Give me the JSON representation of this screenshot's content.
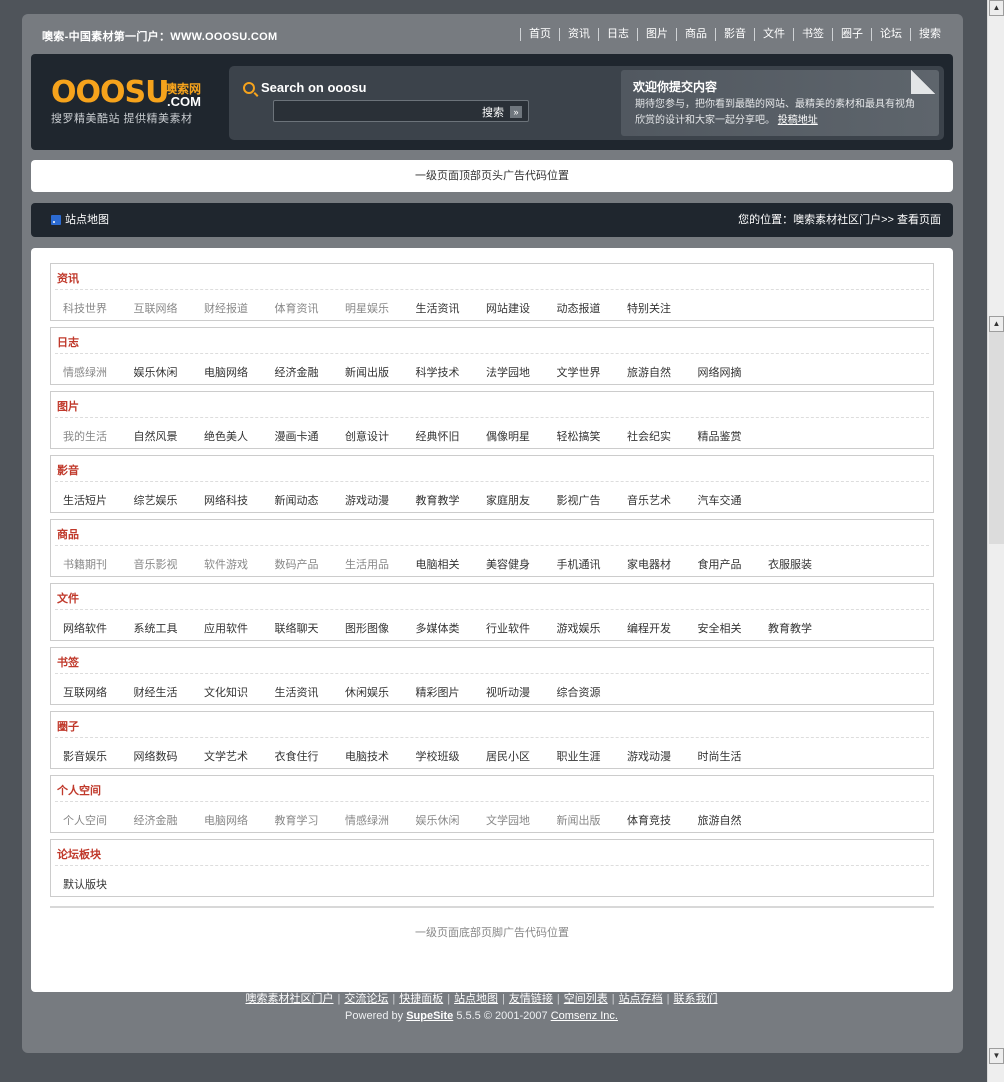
{
  "topbar": {
    "site_title": "噢索-中国素材第一门户：WWW.OOOSU.COM",
    "nav": [
      "首页",
      "资讯",
      "日志",
      "图片",
      "商品",
      "影音",
      "文件",
      "书签",
      "圈子",
      "论坛",
      "搜索"
    ]
  },
  "logo": {
    "word": "OOOSU",
    "cn": "噢索网",
    "com": ".COM",
    "slogan": "搜罗精美酷站 提供精美素材"
  },
  "search": {
    "title": "Search on ooosu",
    "button": "搜索",
    "value": ""
  },
  "submit": {
    "title": "欢迎你提交内容",
    "text": "期待您参与，把你看到最酷的网站、最精美的素材和最具有视角欣赏的设计和大家一起分享吧。",
    "link": "投稿地址"
  },
  "ad_top": "一级页面顶部页头广告代码位置",
  "crumb": {
    "sitemap": "站点地图",
    "position": "您的位置：噢索素材社区门户>> 查看页面"
  },
  "sections": [
    {
      "title": "资讯",
      "items": [
        "科技世界",
        "互联网络",
        "财经报道",
        "体育资讯",
        "明星娱乐",
        "生活资讯",
        "网站建设",
        "动态报道",
        "特别关注"
      ],
      "dim": 5
    },
    {
      "title": "日志",
      "items": [
        "情感绿洲",
        "娱乐休闲",
        "电脑网络",
        "经济金融",
        "新闻出版",
        "科学技术",
        "法学园地",
        "文学世界",
        "旅游自然",
        "网络网摘"
      ],
      "dim": 1
    },
    {
      "title": "图片",
      "items": [
        "我的生活",
        "自然风景",
        "绝色美人",
        "漫画卡通",
        "创意设计",
        "经典怀旧",
        "偶像明星",
        "轻松搞笑",
        "社会纪实",
        "精品鉴赏"
      ],
      "dim": 1
    },
    {
      "title": "影音",
      "items": [
        "生活短片",
        "综艺娱乐",
        "网络科技",
        "新闻动态",
        "游戏动漫",
        "教育教学",
        "家庭朋友",
        "影视广告",
        "音乐艺术",
        "汽车交通"
      ],
      "dim": 0
    },
    {
      "title": "商品",
      "items": [
        "书籍期刊",
        "音乐影视",
        "软件游戏",
        "数码产品",
        "生活用品",
        "电脑相关",
        "美容健身",
        "手机通讯",
        "家电器材",
        "食用产品",
        "衣服服装"
      ],
      "dim": 5
    },
    {
      "title": "文件",
      "items": [
        "网络软件",
        "系统工具",
        "应用软件",
        "联络聊天",
        "图形图像",
        "多媒体类",
        "行业软件",
        "游戏娱乐",
        "编程开发",
        "安全相关",
        "教育教学"
      ],
      "dim": 0
    },
    {
      "title": "书签",
      "items": [
        "互联网络",
        "财经生活",
        "文化知识",
        "生活资讯",
        "休闲娱乐",
        "精彩图片",
        "视听动漫",
        "综合资源"
      ],
      "dim": 0
    },
    {
      "title": "圈子",
      "items": [
        "影音娱乐",
        "网络数码",
        "文学艺术",
        "衣食住行",
        "电脑技术",
        "学校班级",
        "居民小区",
        "职业生涯",
        "游戏动漫",
        "时尚生活"
      ],
      "dim": 0
    },
    {
      "title": "个人空间",
      "items": [
        "个人空间",
        "经济金融",
        "电脑网络",
        "教育学习",
        "情感绿洲",
        "娱乐休闲",
        "文学园地",
        "新闻出版",
        "体育竞技",
        "旅游自然"
      ],
      "dim": 8
    },
    {
      "title": "论坛板块",
      "items": [
        "默认版块"
      ],
      "dim": 0
    }
  ],
  "ad_bottom": "一级页面底部页脚广告代码位置",
  "footer": {
    "links": [
      "噢索素材社区门户",
      "交流论坛",
      "快捷面板",
      "站点地图",
      "友情链接",
      "空间列表",
      "站点存档",
      "联系我们"
    ],
    "powered_prefix": "Powered by ",
    "powered_brand": "SupeSite",
    "powered_version": " 5.5.5 © 2001-2007 ",
    "powered_company": "Comsenz Inc."
  }
}
